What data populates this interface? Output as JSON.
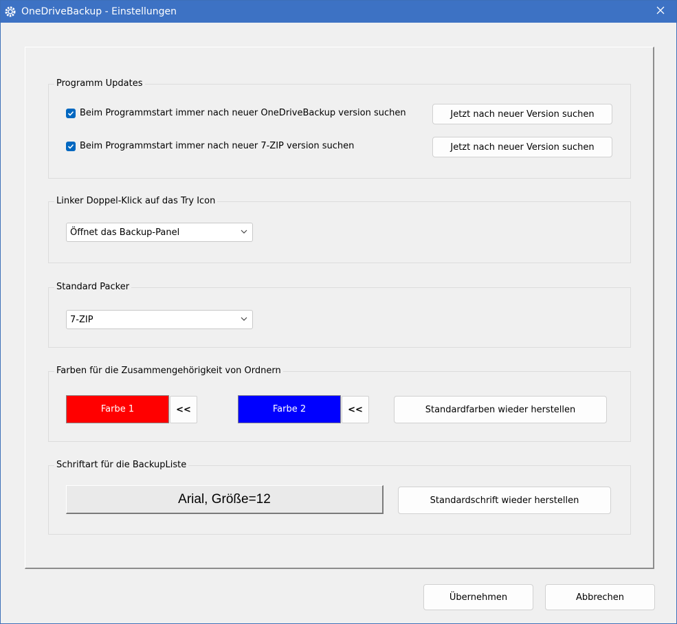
{
  "window": {
    "title": "OneDriveBackup - Einstellungen"
  },
  "groups": {
    "updates": {
      "title": "Programm Updates",
      "rows": [
        {
          "label": "Beim Programmstart immer nach neuer OneDriveBackup version suchen",
          "checked": true,
          "button": "Jetzt nach neuer Version suchen"
        },
        {
          "label": "Beim Programmstart immer nach neuer 7-ZIP version suchen",
          "checked": true,
          "button": "Jetzt nach neuer Version suchen"
        }
      ]
    },
    "doubleclick": {
      "title": "Linker Doppel-Klick auf das Try Icon",
      "selected": "Öffnet das Backup-Panel"
    },
    "packer": {
      "title": "Standard Packer",
      "selected": "7-ZIP"
    },
    "colors": {
      "title": "Farben für die Zusammengehörigkeit von Ordnern",
      "color1": {
        "label": "Farbe 1",
        "color": "#ff0000",
        "pick_label": "<<"
      },
      "color2": {
        "label": "Farbe 2",
        "color": "#0000ff",
        "pick_label": "<<"
      },
      "reset_label": "Standardfarben wieder herstellen"
    },
    "font": {
      "title": "Schriftart für die BackupListe",
      "current": "Arial, Größe=12",
      "reset_label": "Standardschrift wieder herstellen"
    }
  },
  "footer": {
    "apply_label": "Übernehmen",
    "cancel_label": "Abbrechen"
  },
  "theme": {
    "titlebar": "#3d72c4",
    "checkbox": "#0067c0"
  }
}
